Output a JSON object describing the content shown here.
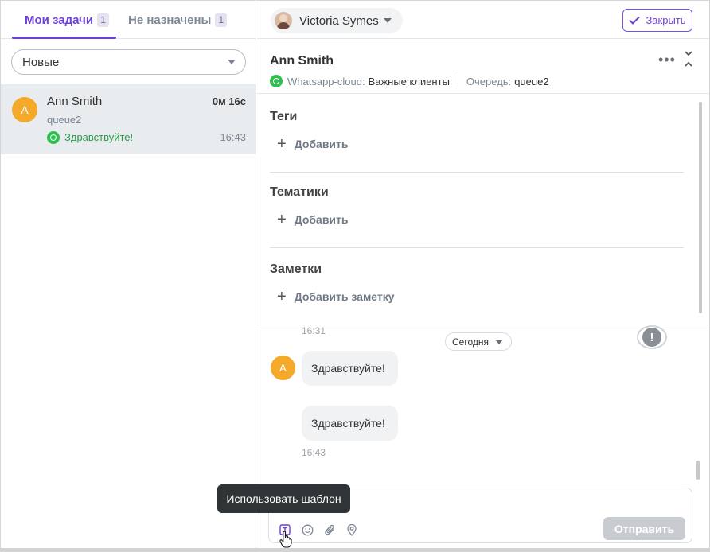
{
  "left": {
    "tabs": [
      {
        "label": "Мои задачи",
        "count": "1"
      },
      {
        "label": "Не назначены",
        "count": "1"
      }
    ],
    "filter": "Новые",
    "task": {
      "avatar": "A",
      "name": "Ann Smith",
      "elapsed": "0м 16с",
      "queue": "queue2",
      "preview": "Здравствуйте!",
      "time": "16:43"
    }
  },
  "topbar": {
    "agent_name": "Victoria Symes",
    "close_label": "Закрыть"
  },
  "header": {
    "client_name": "Ann Smith",
    "channel_label": "Whatsapp-cloud:",
    "channel_value": "Важные клиенты",
    "queue_label": "Очередь:",
    "queue_value": "queue2"
  },
  "sections": {
    "tags": {
      "title": "Теги",
      "add": "Добавить"
    },
    "topics": {
      "title": "Тематики",
      "add": "Добавить"
    },
    "notes": {
      "title": "Заметки",
      "add": "Добавить заметку"
    }
  },
  "chat": {
    "prev_time": "16:31",
    "date_chip": "Сегодня",
    "avatar": "A",
    "messages": [
      "Здравствуйте!",
      "Здравствуйте!"
    ],
    "last_time": "16:43",
    "alert_symbol": "!"
  },
  "composer": {
    "send_label": "Отправить",
    "tooltip": "Использовать шаблон"
  },
  "colors": {
    "accent": "#6c3fd6",
    "whatsapp": "#2fbf4e",
    "avatar": "#f4a92a"
  },
  "icons": [
    "whatsapp-icon",
    "chevron-down-icon",
    "check-icon",
    "more-icon",
    "collapse-icon",
    "plus-icon",
    "alert-icon",
    "template-icon",
    "emoji-icon",
    "attach-icon",
    "location-icon",
    "hand-cursor-icon"
  ]
}
